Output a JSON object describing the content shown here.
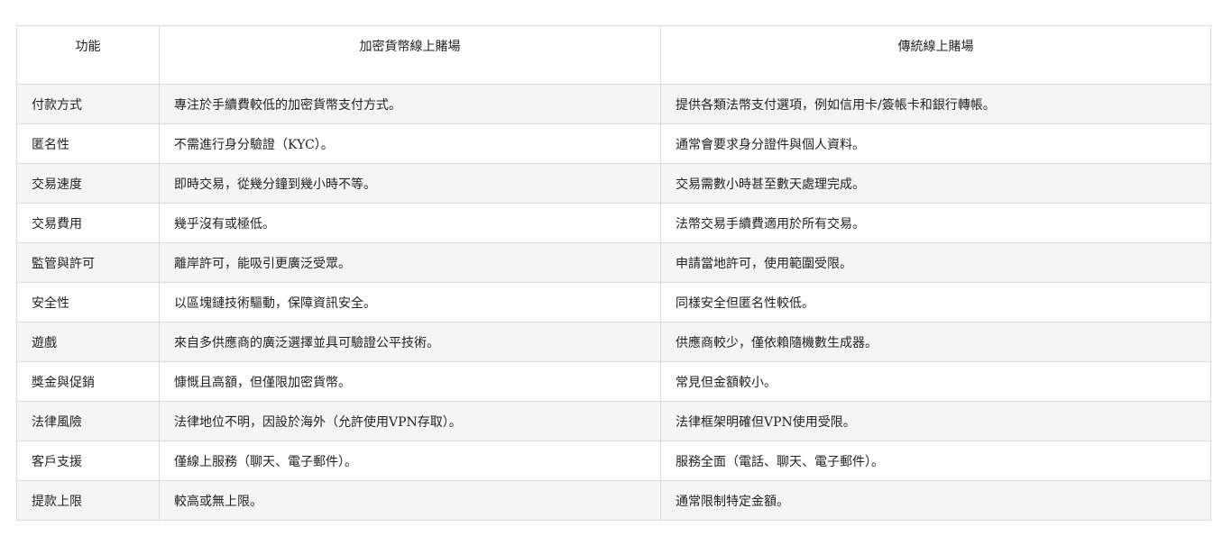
{
  "table": {
    "headers": [
      "功能",
      "加密貨幣線上賭場",
      "傳統線上賭場"
    ],
    "rows": [
      [
        "付款方式",
        "專注於手續費較低的加密貨幣支付方式。",
        "提供各類法幣支付選項，例如信用卡/簽帳卡和銀行轉帳。"
      ],
      [
        "匿名性",
        "不需進行身分驗證（KYC）。",
        "通常會要求身分證件與個人資料。"
      ],
      [
        "交易速度",
        "即時交易，從幾分鐘到幾小時不等。",
        "交易需數小時甚至數天處理完成。"
      ],
      [
        "交易費用",
        "幾乎沒有或極低。",
        "法幣交易手續費適用於所有交易。"
      ],
      [
        "監管與許可",
        "離岸許可，能吸引更廣泛受眾。",
        "申請當地許可，使用範圍受限。"
      ],
      [
        "安全性",
        "以區塊鏈技術驅動，保障資訊安全。",
        "同樣安全但匿名性較低。"
      ],
      [
        "遊戲",
        "來自多供應商的廣泛選擇並具可驗證公平技術。",
        "供應商較少，僅依賴隨機數生成器。"
      ],
      [
        "獎金與促銷",
        "慷慨且高額，但僅限加密貨幣。",
        "常見但金額較小。"
      ],
      [
        "法律風險",
        "法律地位不明，因設於海外（允許使用VPN存取）。",
        "法律框架明確但VPN使用受限。"
      ],
      [
        "客戶支援",
        "僅線上服務（聊天、電子郵件）。",
        "服務全面（電話、聊天、電子郵件）。"
      ],
      [
        "提款上限",
        "較高或無上限。",
        "通常限制特定金額。"
      ]
    ]
  }
}
